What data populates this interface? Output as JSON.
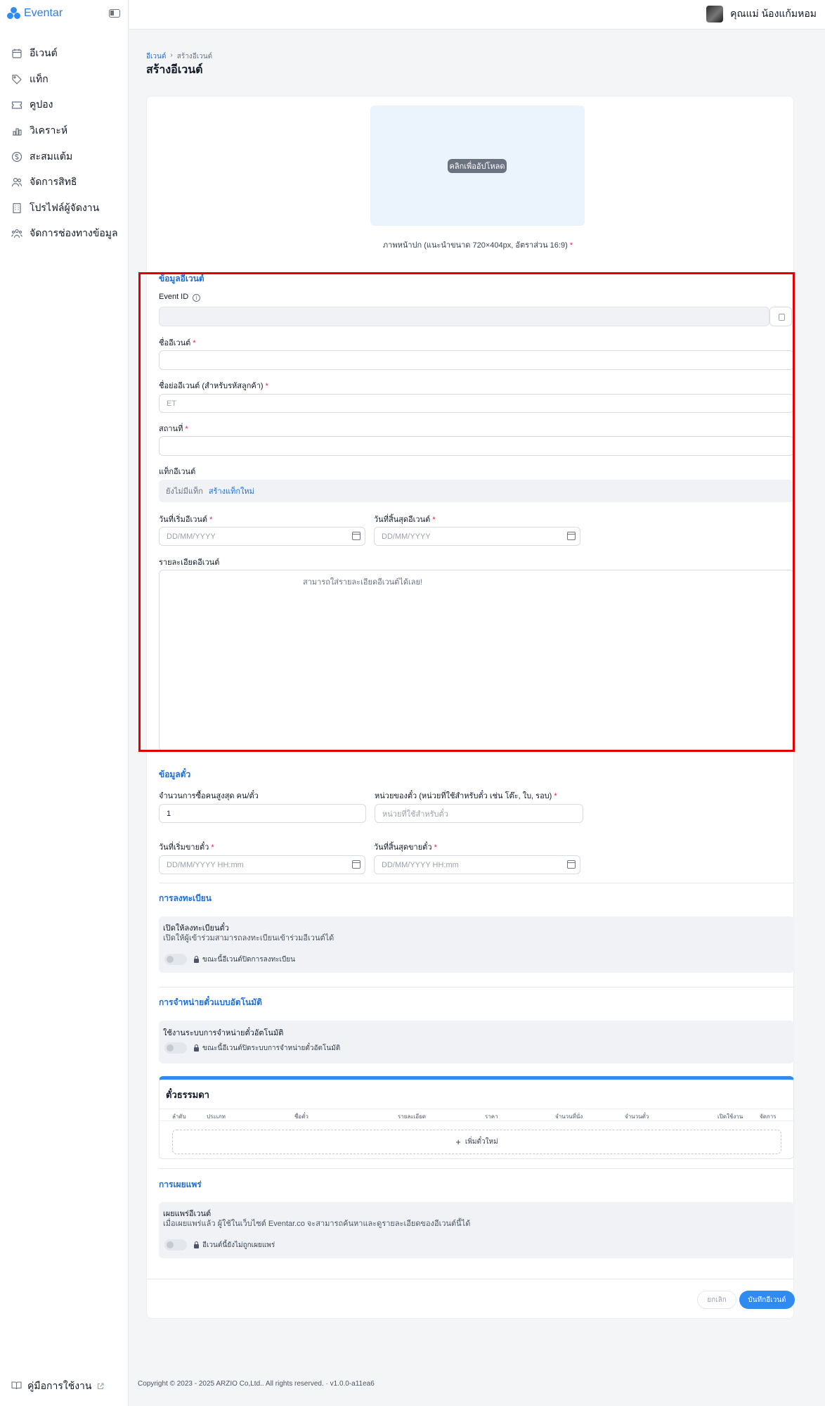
{
  "brand": {
    "name": "Eventar"
  },
  "sidebar": {
    "items": [
      {
        "label": "อีเวนต์",
        "icon": "calendar-icon"
      },
      {
        "label": "แท็ก",
        "icon": "tag-icon"
      },
      {
        "label": "คูปอง",
        "icon": "ticket-icon"
      },
      {
        "label": "วิเคราะห์",
        "icon": "bar-chart-icon"
      },
      {
        "label": "สะสมแต้ม",
        "icon": "coin-icon"
      },
      {
        "label": "จัดการสิทธิ",
        "icon": "users-icon"
      },
      {
        "label": "โปรไฟล์ผู้จัดงาน",
        "icon": "building-icon"
      },
      {
        "label": "จัดการช่องทางข้อมูล",
        "icon": "team-icon"
      }
    ],
    "manual_label": "คู่มือการใช้งาน"
  },
  "topbar": {
    "user_name": "คุณแม่ น้องแก้มหอม"
  },
  "breadcrumb": {
    "parent": "อีเวนต์",
    "separator": "›",
    "current": "สร้างอีเวนต์"
  },
  "page": {
    "title": "สร้างอีเวนต์"
  },
  "cover": {
    "upload_label": "คลิกเพื่ออัปโหลด",
    "caption": "ภาพหน้าปก (แนะนำขนาด 720×404px, อัตราส่วน 16:9)",
    "required_mark": "*"
  },
  "event_info": {
    "section_title": "ข้อมูลอีเวนต์",
    "event_id_label": "Event ID",
    "event_id_value": "",
    "name_label": "ชื่ออีเวนต์",
    "short_name_label": "ชื่อย่ออีเวนต์ (สำหรับรหัสลูกค้า)",
    "short_name_placeholder": "ET",
    "location_label": "สถานที่",
    "tags_label": "แท็กอีเวนต์",
    "tags_empty": "ยังไม่มีแท็ก",
    "tags_create": "สร้างแท็กใหม่",
    "start_date_label": "วันที่เริ่มอีเวนต์",
    "end_date_label": "วันที่สิ้นสุดอีเวนต์",
    "date_placeholder": "DD/MM/YYYY",
    "description_label": "รายละเอียดอีเวนต์",
    "description_placeholder": "สามารถใส่รายละเอียดอีเวนต์ได้เลย!",
    "required_mark": "*"
  },
  "ticket_info": {
    "section_title": "ข้อมูลตั๋ว",
    "max_per_buyer_label": "จำนวนการซื้อคนสูงสุด คน/ตั๋ว",
    "max_per_buyer_value": "1",
    "unit_label": "หน่วยของตั๋ว (หน่วยที่ใช้สำหรับตั๋ว เช่น โต๊ะ, ใบ, รอบ)",
    "unit_placeholder": "หน่วยที่ใช้สำหรับตั๋ว",
    "sale_start_label": "วันที่เริ่มขายตั๋ว",
    "sale_end_label": "วันที่สิ้นสุดขายตั๋ว",
    "datetime_placeholder": "DD/MM/YYYY HH:mm",
    "required_mark": "*"
  },
  "registration": {
    "section_title": "การลงทะเบียน",
    "panel_title": "เปิดให้ลงทะเบียนตั๋ว",
    "panel_desc": "เปิดให้ผู้เข้าร่วมสามารถลงทะเบียนเข้าร่วมอีเวนต์ได้",
    "toggle_note": "ขณะนี้อีเวนต์ปิดการลงทะเบียน"
  },
  "auto_sale": {
    "section_title": "การจำหน่ายตั๋วแบบอัตโนมัติ",
    "panel_title": "ใช้งานระบบการจำหน่ายตั๋วอัตโนมัติ",
    "toggle_note": "ขณะนี้อีเวนต์ปิดระบบการจำหน่ายตั๋วอัตโนมัติ"
  },
  "tickets": {
    "title": "ตั๋วธรรมดา",
    "columns": [
      "ลำดับ",
      "ประเภท",
      "ชื่อตั๋ว",
      "รายละเอียด",
      "ราคา",
      "จำนวนที่นั่ง",
      "จำนวนตั๋ว",
      "เปิดใช้งาน",
      "จัดการ"
    ],
    "add_label": "เพิ่มตั๋วใหม่",
    "add_icon": "plus-icon"
  },
  "publish": {
    "section_title": "การเผยแพร่",
    "panel_title": "เผยแพร่อีเวนต์",
    "panel_desc": "เมื่อเผยแพร่แล้ว ผู้ใช้ในเว็บไซต์ Eventar.co จะสามารถค้นหาและดูรายละเอียดของอีเวนต์นี้ได้",
    "toggle_note": "อีเวนต์นี้ยังไม่ถูกเผยแพร่"
  },
  "actions": {
    "cancel_label": "ยกเลิก",
    "save_label": "บันทึกอีเวนต์"
  },
  "footer": {
    "copyright": "Copyright © 2023 - 2025 ARZIO Co,Ltd.. All rights reserved.  ·  v1.0.0-a11ea6"
  },
  "colors": {
    "accent": "#2f8bf0",
    "link": "#1e6fd9",
    "required": "#e11d48",
    "highlight": "#e00000"
  }
}
